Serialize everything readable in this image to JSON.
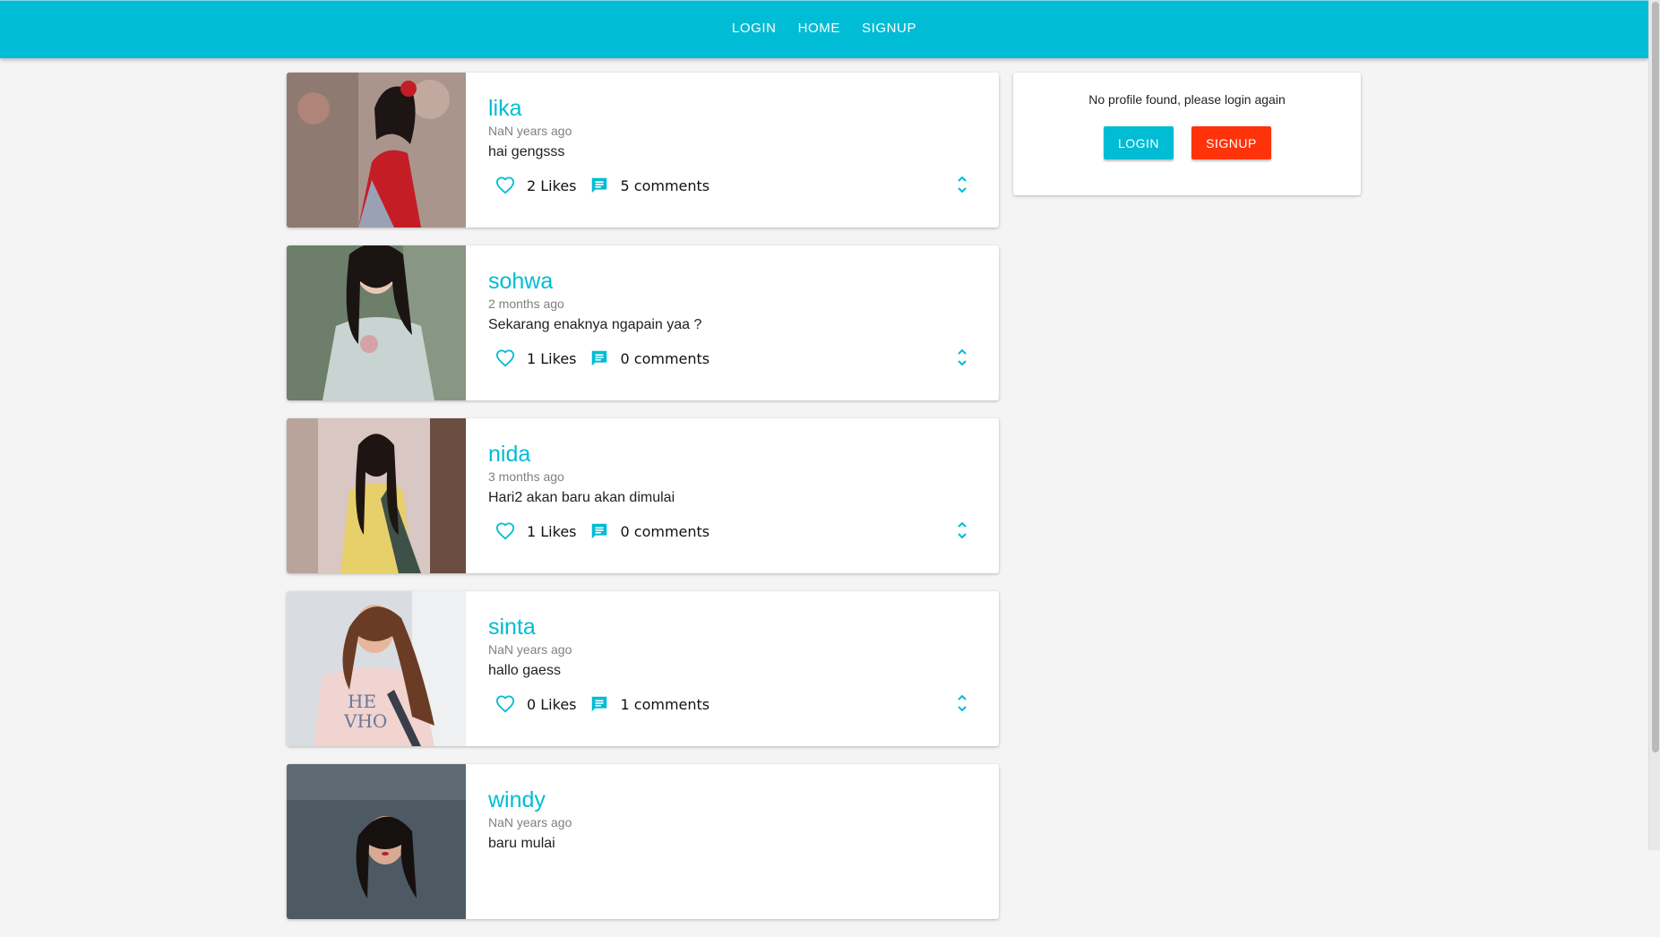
{
  "nav": {
    "items": [
      "LOGIN",
      "HOME",
      "SIGNUP"
    ]
  },
  "posts": [
    {
      "user": "lika",
      "time": "NaN years ago",
      "text": "hai gengsss",
      "likes": "2 Likes",
      "comments": "5 comments"
    },
    {
      "user": "sohwa",
      "time": "2 months ago",
      "text": "Sekarang enaknya ngapain yaa ?",
      "likes": "1 Likes",
      "comments": "0 comments"
    },
    {
      "user": "nida",
      "time": "3 months ago",
      "text": "Hari2 akan baru akan dimulai",
      "likes": "1 Likes",
      "comments": "0 comments"
    },
    {
      "user": "sinta",
      "time": "NaN years ago",
      "text": "hallo gaess",
      "likes": "0 Likes",
      "comments": "1 comments"
    },
    {
      "user": "windy",
      "time": "NaN years ago",
      "text": "baru mulai",
      "likes": "",
      "comments": ""
    }
  ],
  "sidebar": {
    "message": "No profile found, please login again",
    "login_label": "LOGIN",
    "signup_label": "SIGNUP"
  },
  "icons": {
    "like": "heart-outline-icon",
    "comment": "comment-icon",
    "expand": "unfold-more-icon"
  },
  "colors": {
    "primary": "#00bcd4",
    "accent": "#ff3309",
    "background": "#f4f4f4"
  }
}
